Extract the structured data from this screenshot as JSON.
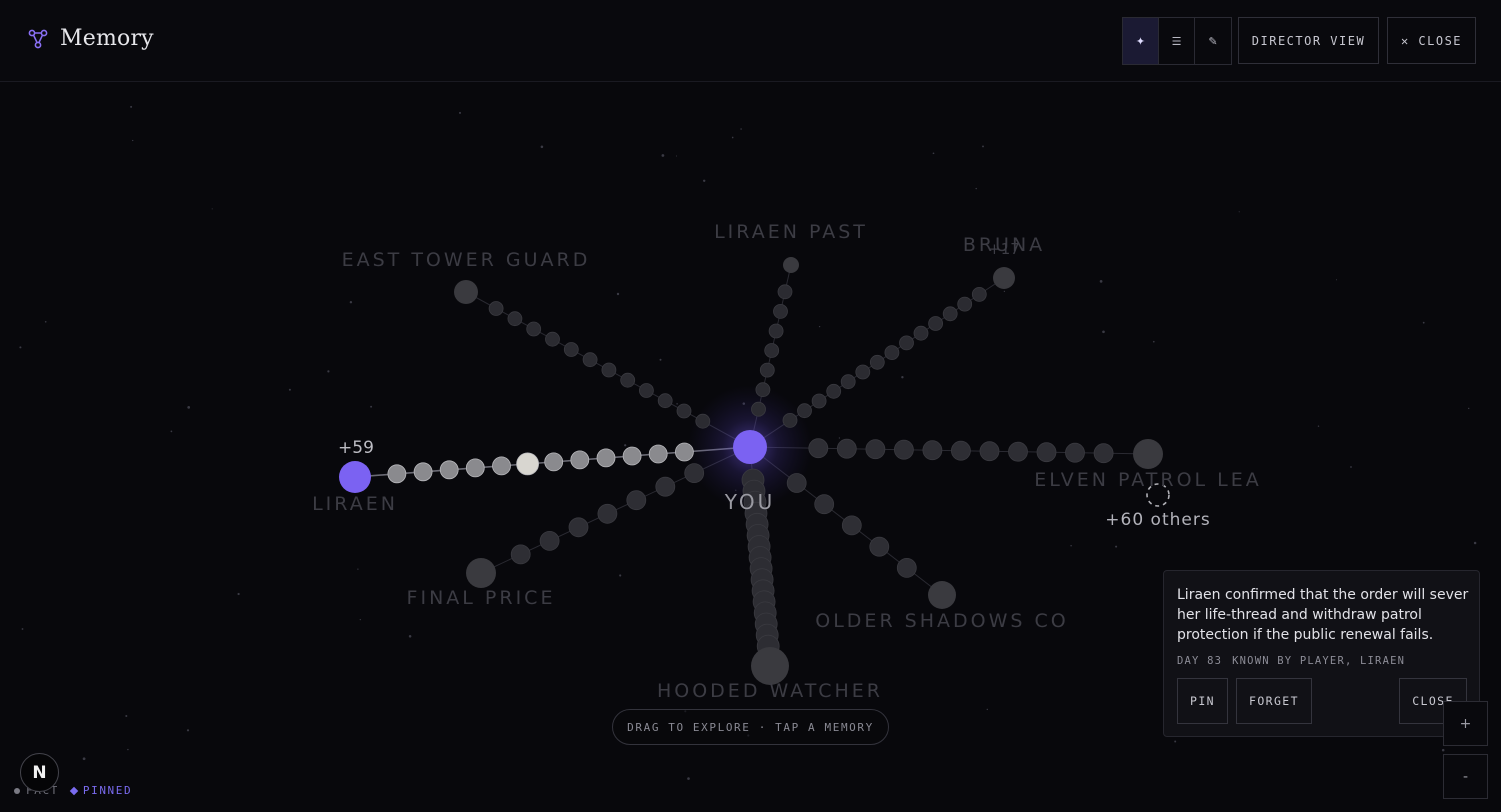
{
  "header": {
    "title": "Memory",
    "modes": [
      {
        "icon": "sparkle-icon",
        "glyph": "✦",
        "active": true
      },
      {
        "icon": "list-icon",
        "glyph": "☰",
        "active": false
      },
      {
        "icon": "pencil-icon",
        "glyph": "✎",
        "active": false
      }
    ],
    "director_label": "DIRECTOR VIEW",
    "close_label": "✕ CLOSE"
  },
  "graph": {
    "center": {
      "label": "YOU",
      "color": "#7b62f2"
    },
    "accent": "#7b62f2",
    "focused_label_color": "#7a66e8",
    "branches": [
      {
        "name": "LIRAEN",
        "focused": true,
        "badge": "+59"
      },
      {
        "name": "EAST TOWER GUARD"
      },
      {
        "name": "LIRAEN PAST"
      },
      {
        "name": "BRUNA",
        "badge": "+17"
      },
      {
        "name": "ELVEN PATROL LEA"
      },
      {
        "name": "OLDER SHADOWS CO"
      },
      {
        "name": "HOODED WATCHER"
      },
      {
        "name": "FINAL PRICE"
      }
    ],
    "overflow_label": "+60 others"
  },
  "hint": "DRAG TO EXPLORE · TAP A MEMORY",
  "card": {
    "text": "Liraen confirmed that the order will sever her life-thread and withdraw patrol protection if the public renewal fails.",
    "day": "DAY 83",
    "known_by": "KNOWN BY PLAYER, LIRAEN",
    "pin_label": "PIN",
    "forget_label": "FORGET",
    "close_label": "CLOSE"
  },
  "zoom": {
    "in_label": "+",
    "out_label": "-"
  },
  "legend": {
    "fact": "FACT",
    "pinned": "PINNED"
  },
  "badge": "N"
}
